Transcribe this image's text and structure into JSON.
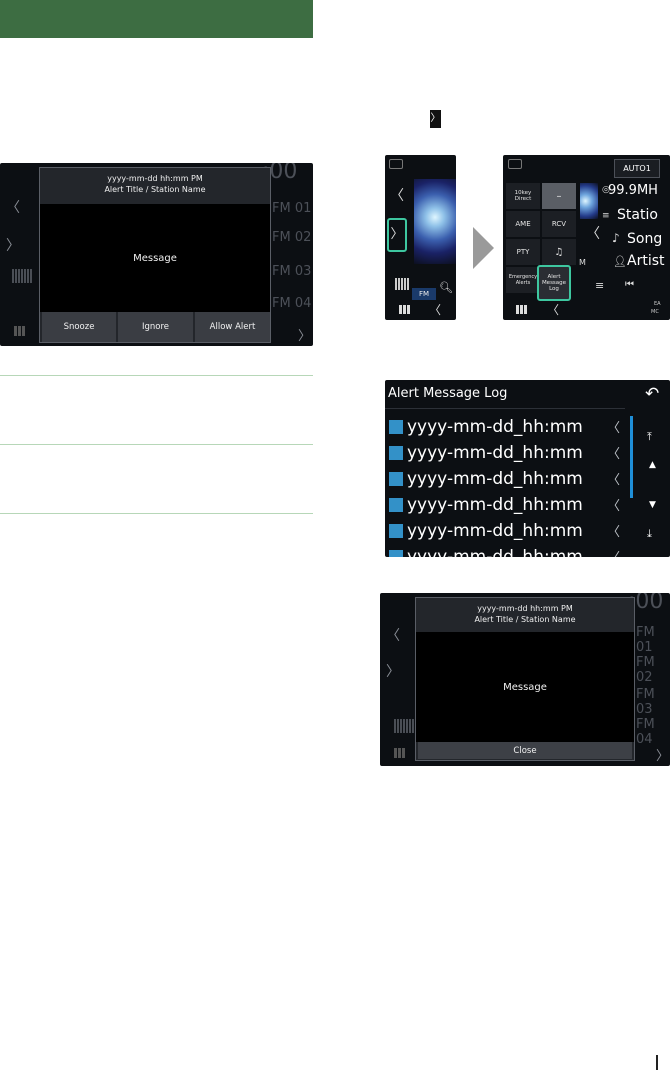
{
  "header_bar": {
    "color": "#3d6d42"
  },
  "step_chevron": "〉",
  "dialog_main": {
    "datetime": "yyyy-mm-dd hh:mm PM",
    "title": "Alert Title / Station Name",
    "message": "Message",
    "buttons": [
      "Snooze",
      "Ignore",
      "Allow Alert"
    ]
  },
  "background_ui": {
    "clock": ":00",
    "presets": [
      "FM 01",
      "FM 02",
      "FM 03",
      "FM 04"
    ]
  },
  "radio_left": {
    "band": "FM"
  },
  "radio_right": {
    "top_button": "AUTO1",
    "frequency": "99.9MH",
    "station": "Statio",
    "song": "Song",
    "artist": "Artist",
    "menu": [
      "10key Direct",
      "–",
      "AME",
      "RCV",
      "PTY",
      "",
      "Emergency Alerts",
      "Alert Message Log"
    ],
    "m_label": "M",
    "ea_mc": [
      "EA",
      "MC"
    ]
  },
  "alert_log": {
    "title": "Alert Message Log",
    "entries": [
      "yyyy-mm-dd_hh:mm",
      "yyyy-mm-dd_hh:mm",
      "yyyy-mm-dd_hh:mm",
      "yyyy-mm-dd_hh:mm",
      "yyyy-mm-dd_hh:mm",
      "yyyy-mm-dd_hh:mm"
    ]
  },
  "dialog_detail": {
    "datetime": "yyyy-mm-dd hh:mm PM",
    "title": "Alert Title / Station Name",
    "message": "Message",
    "close_label": "Close"
  },
  "accent_colors": {
    "highlight": "#3ec7a0",
    "log_blue": "#3391c8",
    "rule_green": "#b7d7b8"
  }
}
